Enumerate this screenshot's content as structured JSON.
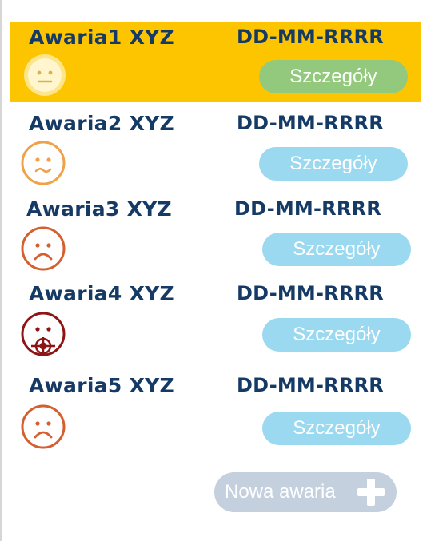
{
  "items": [
    {
      "title": "Awaria1 XYZ",
      "date": "DD-MM-RRRR",
      "details_label": "Szczegóły",
      "icon": "neutral-face-icon",
      "status_color": "#fdc500"
    },
    {
      "title": "Awaria2 XYZ",
      "date": "DD-MM-RRRR",
      "details_label": "Szczegóły",
      "icon": "confused-face-icon",
      "status_color": "#f0a24a"
    },
    {
      "title": "Awaria3 XYZ",
      "date": "DD-MM-RRRR",
      "details_label": "Szczegóły",
      "icon": "sad-face-icon",
      "status_color": "#d45f2f"
    },
    {
      "title": "Awaria4 XYZ",
      "date": "DD-MM-RRRR",
      "details_label": "Szczegóły",
      "icon": "critical-face-icon",
      "status_color": "#8e1515"
    },
    {
      "title": "Awaria5 XYZ",
      "date": "DD-MM-RRRR",
      "details_label": "Szczegóły",
      "icon": "sad-face-icon",
      "status_color": "#d45f2f"
    }
  ],
  "new_button": {
    "label": "Nowa awaria",
    "icon": "plus-icon"
  },
  "colors": {
    "highlight": "#fdc500",
    "text": "#153a66",
    "details_active": "#93c97c",
    "details": "#9ad9ef",
    "new_button": "#c4d0de"
  }
}
